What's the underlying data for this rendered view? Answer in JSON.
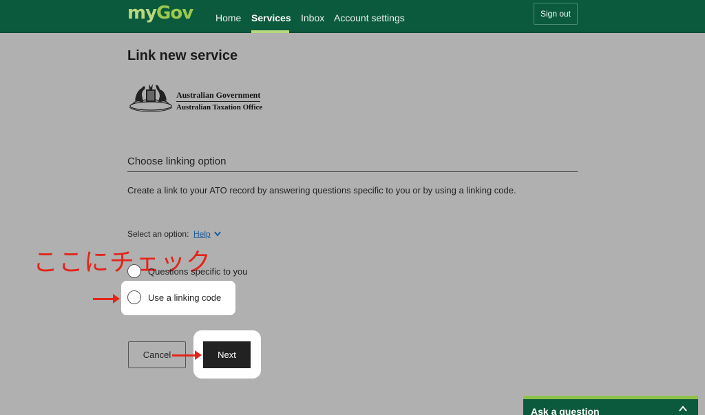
{
  "header": {
    "logo_my": "my",
    "logo_gov": "Gov",
    "nav": [
      {
        "label": "Home"
      },
      {
        "label": "Services"
      },
      {
        "label": "Inbox"
      },
      {
        "label": "Account settings"
      }
    ],
    "active_nav": "Services",
    "sign_out_label": "Sign out"
  },
  "page": {
    "title": "Link new service",
    "agency": {
      "line1": "Australian Government",
      "line2": "Australian Taxation Office",
      "crest_icon": "coat-of-arms-icon"
    },
    "section_heading": "Choose linking option",
    "description": "Create a link to your ATO record by answering questions specific to you or by using a linking code.",
    "select_label": "Select an option:",
    "help_label": "Help",
    "options": [
      {
        "label": "Questions specific to you",
        "selected": false
      },
      {
        "label": "Use a linking code",
        "selected": false
      }
    ],
    "cancel_label": "Cancel",
    "next_label": "Next"
  },
  "annotation": {
    "text": "ここにチェック",
    "color": "#e3241a"
  },
  "ask_panel": {
    "label": "Ask a question",
    "icon": "chevron-up-icon"
  },
  "colors": {
    "brand_green": "#0c5a3e",
    "accent_green": "#8fc04a",
    "overlay_gray": "#b0b0b0"
  }
}
